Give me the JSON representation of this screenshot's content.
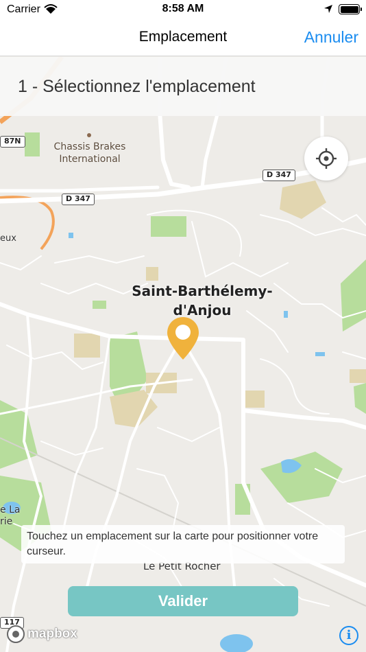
{
  "status_bar": {
    "carrier": "Carrier",
    "time": "8:58 AM"
  },
  "nav": {
    "title": "Emplacement",
    "cancel_label": "Annuler"
  },
  "step": {
    "label": "1 - Sélectionnez l'emplacement"
  },
  "map": {
    "city_label_line1": "Saint-Barthélemy-",
    "city_label_line2": "d'Anjou",
    "poi_line1": "Chassis Brakes",
    "poi_line2": "International",
    "road_d347_a": "D 347",
    "road_d347_b": "D 347",
    "road_87n": "87N",
    "road_117": "117",
    "place_left_top": "eux",
    "place_left_bottom_1": "e La",
    "place_left_bottom_2": "rie",
    "place_bottom": "Le Petit Rocher",
    "attribution": "mapbox",
    "info_label": "i"
  },
  "hint": {
    "text": "Touchez un emplacement sur la carte pour positionner votre curseur."
  },
  "actions": {
    "validate_label": "Valider"
  },
  "colors": {
    "accent": "#1a8cf0",
    "validate": "#77c6c4",
    "pin": "#f0b23c",
    "park": "#b7dd9c",
    "building": "#e2d6b0",
    "water": "#7ec3ee"
  },
  "icons": {
    "locate": "crosshair-icon",
    "pin": "map-pin-icon",
    "wifi": "wifi-icon",
    "location_arrow": "location-arrow-icon",
    "battery": "battery-icon",
    "info": "info-icon"
  }
}
